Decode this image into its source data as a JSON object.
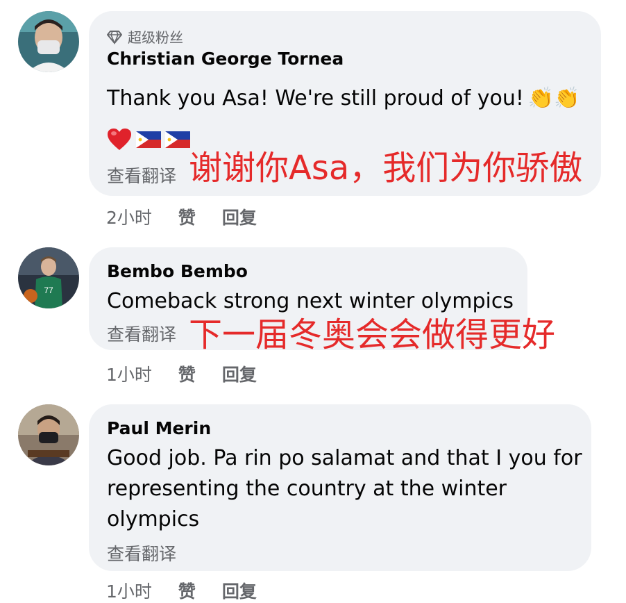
{
  "comments": [
    {
      "badge": "超级粉丝",
      "name": "Christian George Tornea",
      "text": "Thank you Asa! We're still proud of you!",
      "emojis": "👏👏",
      "translate": "查看翻译",
      "overlay": "谢谢你Asa，我们为你骄傲",
      "time": "2小时",
      "like": "赞",
      "reply": "回复"
    },
    {
      "name": "Bembo Bembo",
      "text": "Comeback strong next winter olympics",
      "translate": "查看翻译",
      "overlay": "下一届冬奥会会做得更好",
      "time": "1小时",
      "like": "赞",
      "reply": "回复"
    },
    {
      "name": "Paul Merin",
      "text_lines": [
        "Good job. Pa rin po salamat and that I you for",
        "representing the country at the winter",
        "olympics"
      ],
      "translate": "查看翻译",
      "time": "1小时",
      "like": "赞",
      "reply": "回复"
    }
  ],
  "colors": {
    "bubble": "#f0f2f5",
    "secondary_text": "#65676b",
    "overlay_red": "#e52a2a"
  },
  "icons": {
    "badge": "diamond-icon",
    "heart": "red-heart-emoji",
    "flag": "philippines-flag-emoji",
    "clap": "clapping-hands-emoji"
  }
}
